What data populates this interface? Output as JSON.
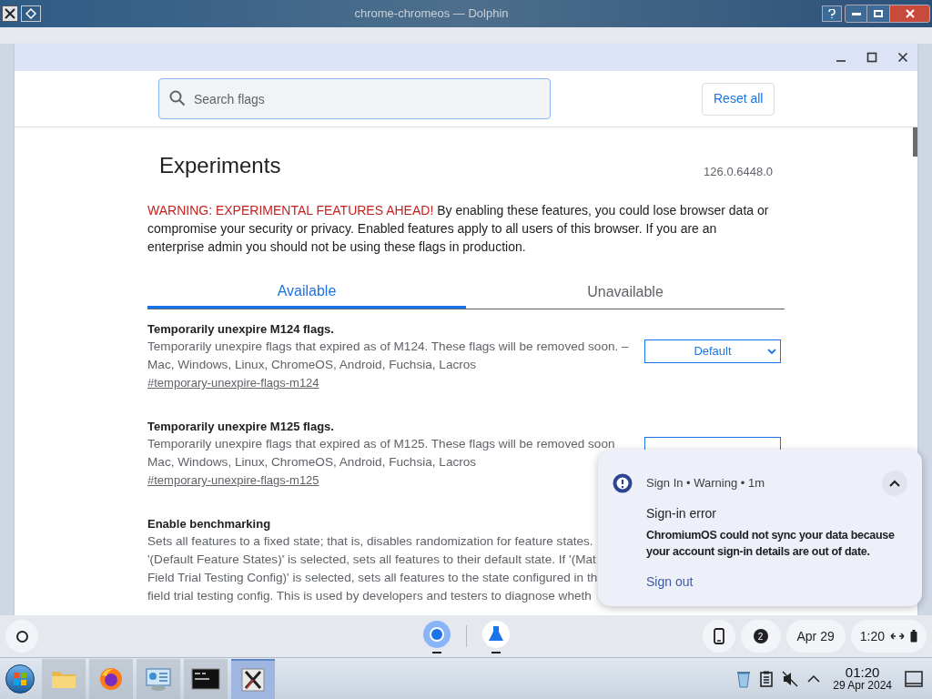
{
  "host_window": {
    "title": "chrome-chromeos — Dolphin"
  },
  "browser": {
    "search": {
      "placeholder": "Search flags"
    },
    "reset_button": "Reset all",
    "heading": "Experiments",
    "version": "126.0.6448.0",
    "warning_label": "WARNING: EXPERIMENTAL FEATURES AHEAD!",
    "warning_text": "By enabling these features, you could lose browser data or compromise your security or privacy. Enabled features apply to all users of this browser. If you are an enterprise admin you should not be using these flags in production.",
    "tabs": [
      {
        "label": "Available",
        "selected": true
      },
      {
        "label": "Unavailable",
        "selected": false
      }
    ],
    "flags": [
      {
        "title": "Temporarily unexpire M124 flags.",
        "description_lines": [
          "Temporarily unexpire flags that expired as of M124. These flags will be removed soon. –",
          "Mac, Windows, Linux, ChromeOS, Android, Fuchsia, Lacros"
        ],
        "link": "#temporary-unexpire-flags-m124",
        "dropdown": "Default"
      },
      {
        "title": "Temporarily unexpire M125 flags.",
        "description_lines": [
          "Temporarily unexpire flags that expired as of M125. These flags will be removed soon",
          "Mac, Windows, Linux, ChromeOS, Android, Fuchsia, Lacros"
        ],
        "link": "#temporary-unexpire-flags-m125"
      },
      {
        "title": "Enable benchmarking",
        "description_lines": [
          "Sets all features to a fixed state; that is, disables randomization for feature states.",
          "'(Default Feature States)' is selected, sets all features to their default state. If '(Mat",
          "Field Trial Testing Config)' is selected, sets all features to the state configured in th",
          "field trial testing config. This is used by developers and testers to diagnose wheth"
        ]
      }
    ]
  },
  "notification": {
    "header": "Sign In • Warning • 1m",
    "title": "Sign-in error",
    "body": "ChromiumOS could not sync your data because your account sign-in details are out of date.",
    "action": "Sign out",
    "expanded": true
  },
  "shelf": {
    "apps": [
      {
        "kind": "chrome",
        "running": true
      },
      {
        "kind": "flask",
        "running": true
      }
    ],
    "notification_count": "2",
    "date": "Apr 29",
    "time": "1:20"
  },
  "taskbar": {
    "apps": [
      {
        "kind": "folder",
        "selected": false
      },
      {
        "kind": "firefox",
        "selected": false
      },
      {
        "kind": "settings",
        "selected": false
      },
      {
        "kind": "terminal",
        "selected": false
      },
      {
        "kind": "xapp",
        "selected": true
      }
    ],
    "clock_time": "01:20",
    "clock_date": "29 Apr 2024"
  }
}
